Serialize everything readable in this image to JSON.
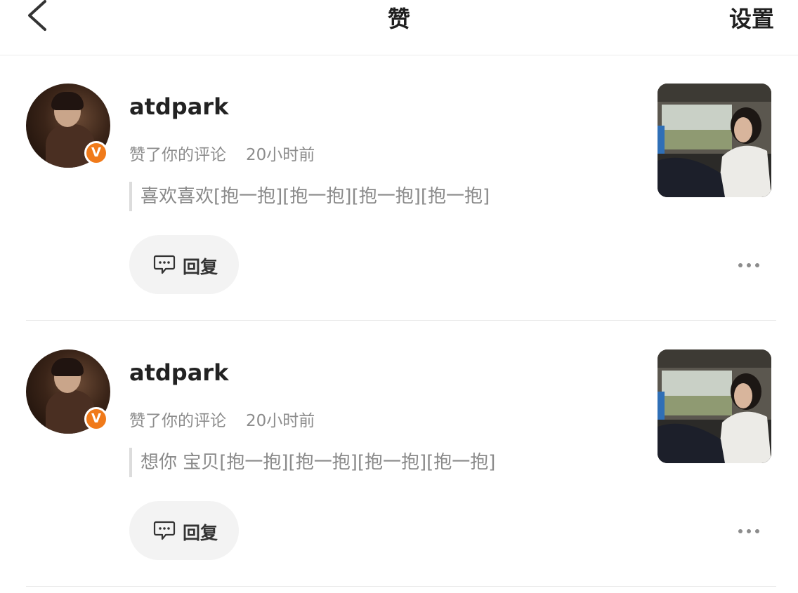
{
  "header": {
    "title": "赞",
    "settings_label": "设置"
  },
  "notifications": [
    {
      "username": "atdpark",
      "action": "赞了你的评论",
      "time": "20小时前",
      "comment": "喜欢喜欢[抱一抱][抱一抱][抱一抱][抱一抱]",
      "reply_label": "回复",
      "verified_badge": "V"
    },
    {
      "username": "atdpark",
      "action": "赞了你的评论",
      "time": "20小时前",
      "comment": "想你  宝贝[抱一抱][抱一抱][抱一抱][抱一抱]",
      "reply_label": "回复",
      "verified_badge": "V"
    }
  ],
  "colors": {
    "badge": "#f07a1a",
    "reply_bg": "#f3f3f3",
    "meta_text": "#8c8c8c"
  }
}
